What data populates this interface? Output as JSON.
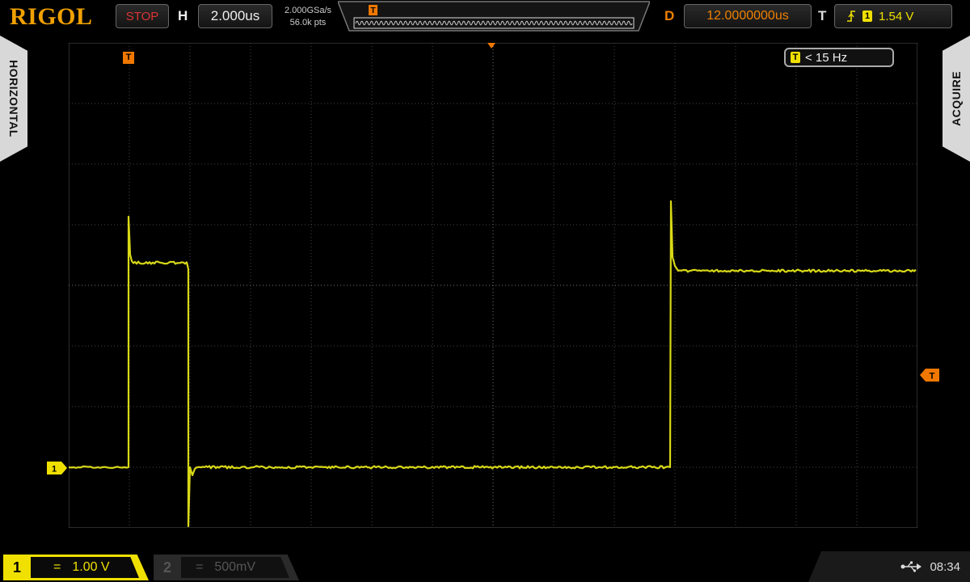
{
  "header": {
    "brand": "RIGOL",
    "run_status": "STOP",
    "h_label": "H",
    "timebase": "2.000us",
    "sample_rate": "2.000GSa/s",
    "mem_depth": "56.0k pts",
    "d_label": "D",
    "delay": "12.0000000us",
    "t_label": "T",
    "trigger_source": "1",
    "trigger_level": "1.54 V"
  },
  "side": {
    "left_tab": "HORIZONTAL",
    "right_tab": "ACQUIRE"
  },
  "screen": {
    "trigger_marker": "T",
    "ch1_marker": "1",
    "freq_badge": "T",
    "freq_readout": "< 15 Hz"
  },
  "channels": {
    "ch1": {
      "number": "1",
      "coupling": "=",
      "scale": "1.00 V"
    },
    "ch2": {
      "number": "2",
      "coupling": "=",
      "scale": "500mV"
    }
  },
  "status": {
    "time": "08:34"
  },
  "colors": {
    "ch1": "#d8d818",
    "trigger": "#f07800",
    "brand": "#f0a000",
    "stop": "#dd3333"
  }
}
